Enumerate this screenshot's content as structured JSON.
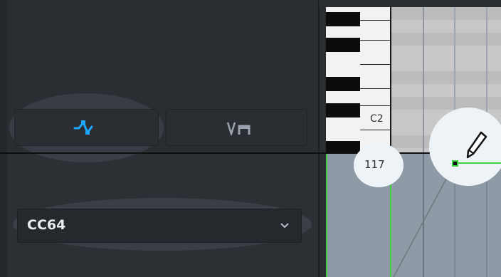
{
  "inspector": {
    "mode_buttons": [
      {
        "name": "draw-mode",
        "icon": "line-draw-icon",
        "active": true,
        "accent": "#1fa8ff"
      },
      {
        "name": "velocity-mode",
        "icon": "velocity-ramp-icon",
        "active": false
      }
    ],
    "controller_select": {
      "value": "CC64"
    }
  },
  "piano": {
    "octave_label": "C2"
  },
  "cc_lane": {
    "value_tooltip": "117",
    "line_color": "#3fd23f",
    "cursor_icon": "pencil-icon"
  }
}
